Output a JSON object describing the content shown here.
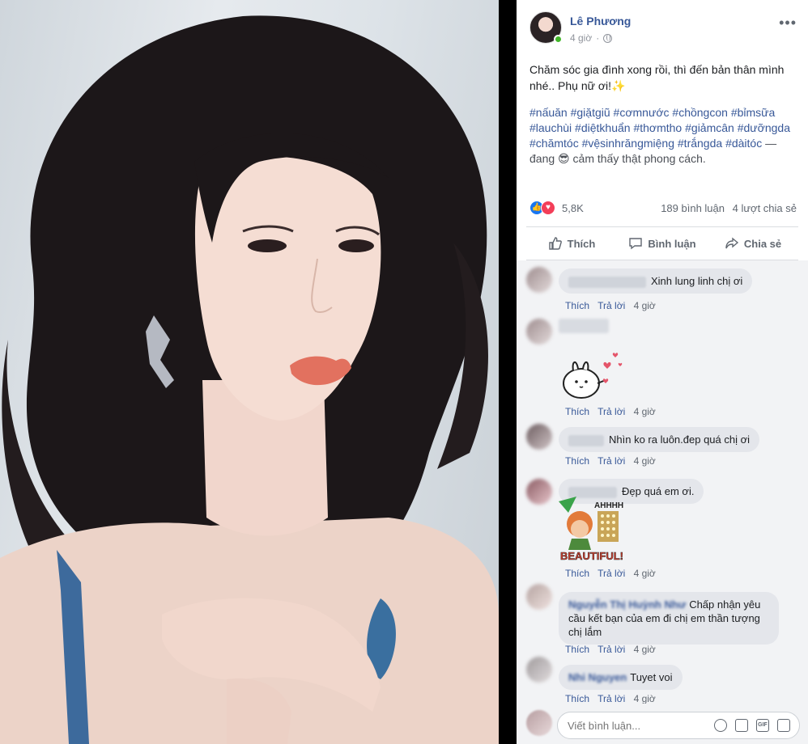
{
  "post": {
    "author": "Lê Phương",
    "time": "4 giờ",
    "more_icon": "ellipsis-icon",
    "text": "Chăm sóc gia đình xong rồi, thì đến bản thân mình nhé.. Phụ nữ ơi!✨",
    "hashtags": [
      "#nấuăn",
      "#giặtgiũ",
      "#cơmnước",
      "#chồngcon",
      "#bỉmsữa",
      "#lauchùi",
      "#diệtkhuẩn",
      "#thơmtho",
      "#giảmcân",
      "#dưỡngda",
      "#chămtóc",
      "#vệsinhrăngmiệng",
      "#trắngda",
      "#dàitóc"
    ],
    "feeling_prefix": "— đang",
    "feeling_emoji": "😎",
    "feeling_text": "cảm thấy thật phong cách."
  },
  "stats": {
    "reactions": "5,8K",
    "comments": "189 bình luận",
    "shares": "4 lượt chia sẻ"
  },
  "actions": {
    "like": "Thích",
    "comment": "Bình luận",
    "share": "Chia sẻ"
  },
  "comments": [
    {
      "name": "",
      "text": "Xinh lung linh chị ơi",
      "like": "Thích",
      "reply": "Trả lời",
      "time": "4 giờ"
    },
    {
      "name": "",
      "text": "",
      "sticker": "bunny-hearts-sticker",
      "like": "Thích",
      "reply": "Trả lời",
      "time": "4 giờ"
    },
    {
      "name": "",
      "text": "Nhìn ko ra luôn.đep quá chị ơi",
      "like": "Thích",
      "reply": "Trả lời",
      "time": "4 giờ"
    },
    {
      "name": "",
      "text": "Đẹp quá em ơi.",
      "sticker": "beautiful-sticker",
      "sticker_top": "AHHHH",
      "sticker_bottom": "BEAUTIFUL!",
      "like": "Thích",
      "reply": "Trả lời",
      "time": "4 giờ"
    },
    {
      "name": "Nguyễn Thị Huỳnh Như",
      "text": "Chấp nhận yêu cầu kết bạn của em đi chị em thần tượng chị lắm",
      "like": "Thích",
      "reply": "Trả lời",
      "time": "4 giờ"
    },
    {
      "name": "Nhi Nguyen",
      "text": "Tuyet voi",
      "like": "Thích",
      "reply": "Trả lời",
      "time": "4 giờ"
    }
  ],
  "composer": {
    "placeholder": "Viết bình luận...",
    "icons": [
      "emoji-icon",
      "camera-icon",
      "gif-icon",
      "sticker-icon"
    ],
    "gif_label": "GIF"
  }
}
